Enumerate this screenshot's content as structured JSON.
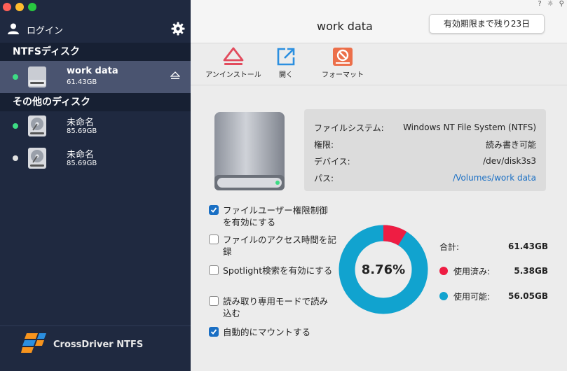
{
  "sidebar": {
    "login_label": "ログイン",
    "ntfs_header": "NTFSディスク",
    "other_header": "その他のディスク",
    "ntfs_disks": [
      {
        "name": "work data",
        "size": "61.43GB",
        "status_color": "#3ddc84"
      }
    ],
    "other_disks": [
      {
        "name": "未命名",
        "size": "85.69GB",
        "status_color": "#3ddc84"
      },
      {
        "name": "未命名",
        "size": "85.69GB",
        "status_color": "#e0e0e0"
      }
    ],
    "brand": "CrossDriver NTFS",
    "icons": [
      "user-icon",
      "gear-icon",
      "drive-icon",
      "eject-icon",
      "brand-logo-icon"
    ]
  },
  "header": {
    "title": "work data",
    "trial_badge": "有効期限まで残り23日",
    "window_icons": [
      "?",
      "☼",
      "⚲"
    ]
  },
  "toolbar": {
    "uninstall": "アンインストール",
    "open": "開く",
    "format": "フォーマット"
  },
  "info": {
    "filesystem_label": "ファイルシステム:",
    "filesystem_value": "Windows NT File System (NTFS)",
    "permission_label": "権限:",
    "permission_value": "読み書き可能",
    "device_label": "デバイス:",
    "device_value": "/dev/disk3s3",
    "path_label": "パス:",
    "path_value": "/Volumes/work data"
  },
  "options": [
    {
      "label": "ファイルユーザー権限制御を有効にする",
      "checked": true
    },
    {
      "label": "ファイルのアクセス時間を記録",
      "checked": false
    },
    {
      "label": "Spotlight検索を有効にする",
      "checked": false
    },
    {
      "label": "読み取り専用モードで読み込む",
      "checked": false
    },
    {
      "label": "自動的にマウントする",
      "checked": true
    }
  ],
  "usage": {
    "percent_label": "8.76%",
    "used_fraction": 0.0876,
    "total_label": "合計:",
    "total_value": "61.43GB",
    "used_label": "使用済み:",
    "used_value": "5.38GB",
    "free_label": "使用可能:",
    "free_value": "56.05GB",
    "used_color": "#ee1d43",
    "free_color": "#11a3cf"
  }
}
